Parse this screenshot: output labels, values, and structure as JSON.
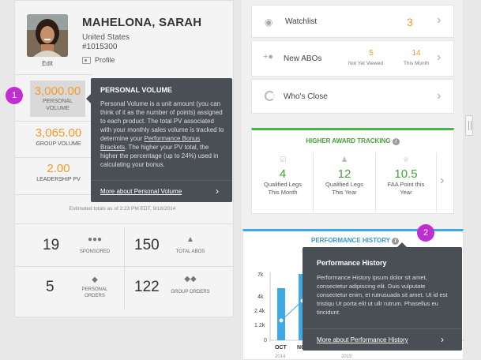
{
  "profile": {
    "name": "MAHELONA, SARAH",
    "country": "United States",
    "id": "#1015300",
    "edit_label": "Edit",
    "profile_label": "Profile"
  },
  "metrics": {
    "personal_volume": {
      "value": "3,000.00",
      "label_line1": "PERSONAL",
      "label_line2": "VOLUME"
    },
    "group_volume": {
      "value": "3,065.00",
      "label": "GROUP VOLUME"
    },
    "leadership_pv": {
      "value": "2.00",
      "label": "LEADERSHIP PV"
    },
    "estimate_note": "Estimated totals as of 2:23 PM EDT, 9/18/2014"
  },
  "stats": [
    {
      "value": "19",
      "label": "SPONSORED",
      "icon": "people-icon"
    },
    {
      "value": "150",
      "label": "TOTAL ABOS",
      "icon": "network-icon"
    },
    {
      "value": "5",
      "label_line1": "PERSONAL",
      "label_line2": "ORDERS",
      "icon": "tag-icon"
    },
    {
      "value": "122",
      "label": "GROUP ORDERS",
      "icon": "tags-icon"
    }
  ],
  "pv_tooltip": {
    "title": "PERSONAL VOLUME",
    "body_before": "Personal Volume is a unit amount (you can think of it as the number of points) assigned to each product.  The total PV associated with your monthly sales volume is tracked to determine your ",
    "body_link": "Performance Bonus Brackets",
    "body_after": ".  The higher your PV total, the higher the percentage (up to 24%) used in calculating your bonus.",
    "link": "More about Personal Volume"
  },
  "right": {
    "watchlist": {
      "label": "Watchlist",
      "count": "3"
    },
    "new_abos": {
      "label": "New ABOs",
      "not_viewed_value": "5",
      "not_viewed_label": "Not Yet Viewed",
      "this_month_value": "14",
      "this_month_label": "This Month"
    },
    "whos_close": {
      "label": "Who's Close"
    },
    "higher_award": {
      "title": "HIGHER AWARD TRACKING",
      "cells": [
        {
          "value": "4",
          "label_line1": "Qualified Legs",
          "label_line2": "This Month"
        },
        {
          "value": "12",
          "label_line1": "Qualified Legs",
          "label_line2": "This Year"
        },
        {
          "value": "10.5",
          "label_line1": "FAA Point this",
          "label_line2": "Year"
        }
      ]
    },
    "performance_history": {
      "title": "PERFORMANCE HISTORY",
      "y_ticks": [
        "7k",
        "4k",
        "2.4k",
        "1.2k",
        "0"
      ],
      "x_labels": [
        "OCT",
        "NO"
      ],
      "year_left": "2014",
      "year_right": "2015"
    }
  },
  "ph_tooltip": {
    "title": "Performance History",
    "body": "Performance History ipsum dolor sit amet, consectetur adipiscing elit. Duis vulputate consectetur enim, et rutrusuada sit amet. Ut id est tristiqu Ut porta elit ut ullr rutrum. Phasellus eu tincidunt.",
    "link": "More about Performance History"
  },
  "badges": {
    "one": "1",
    "two": "2"
  },
  "colors": {
    "orange": "#f19a2e",
    "green": "#3fa535",
    "blue": "#3eaae3",
    "badge": "#c02ed0",
    "tooltip": "#4a4f55"
  }
}
